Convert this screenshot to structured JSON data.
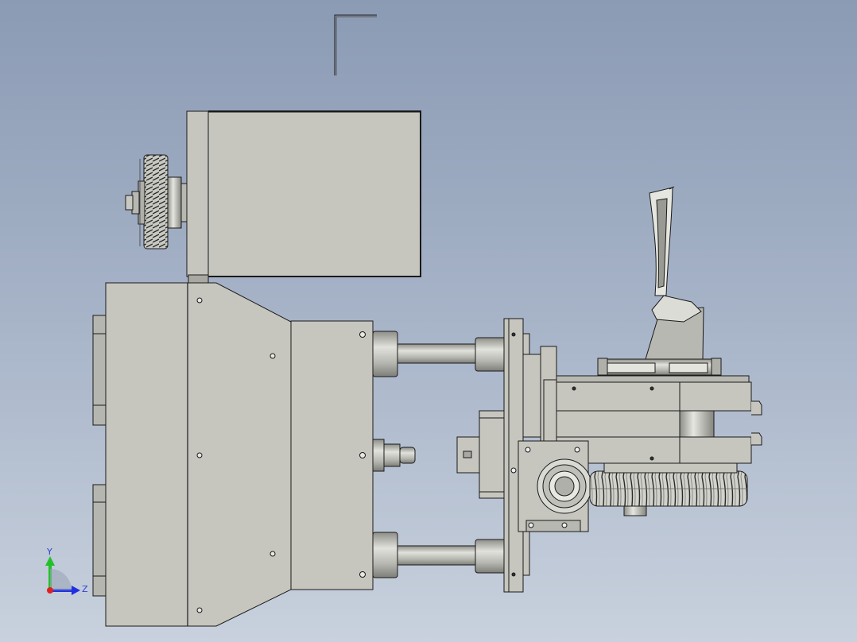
{
  "viewport": {
    "background_top": "#8b9bb4",
    "background_bottom": "#c8d1dd",
    "part_fill": "#c6c6bf",
    "part_shade": "#a9a9a2",
    "edge_color": "#1a1a1a"
  },
  "triad": {
    "x_label": "",
    "y_label": "Y",
    "z_label": "Z",
    "y_color": "#22c02a",
    "z_color": "#2030e0",
    "origin_color": "#e02020"
  }
}
